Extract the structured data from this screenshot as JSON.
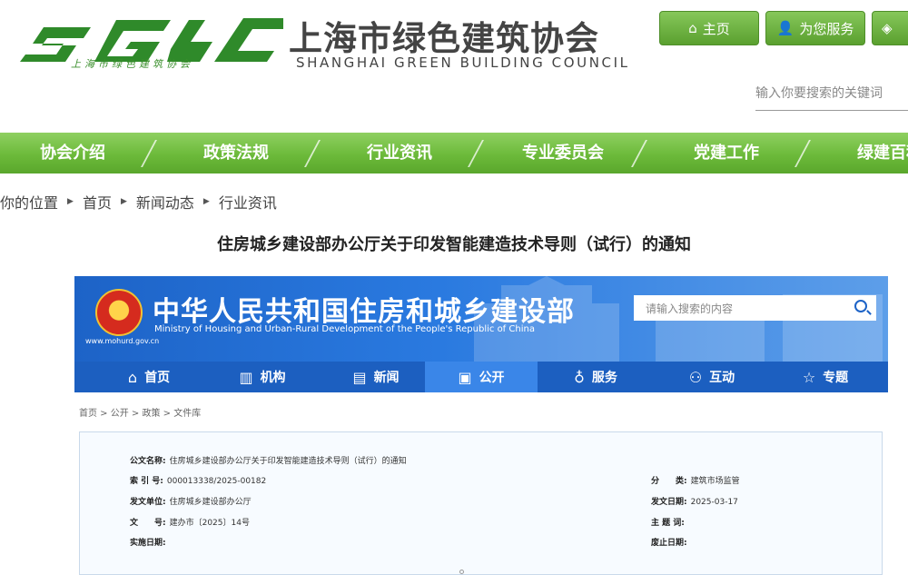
{
  "header": {
    "logo_letters": "SGBC",
    "logo_sub": "上海市绿色建筑协会",
    "org_title": "上海市绿色建筑协会",
    "org_en": "SHANGHAI GREEN BUILDING COUNCIL",
    "buttons": [
      {
        "label": "主页",
        "icon": "home-icon"
      },
      {
        "label": "为您服务",
        "icon": "person-icon"
      },
      {
        "label": "",
        "icon": "tag-icon"
      }
    ],
    "search_placeholder": "输入你要搜索的关键词"
  },
  "nav": {
    "items": [
      "协会介绍",
      "政策法规",
      "行业资讯",
      "专业委员会",
      "党建工作",
      "绿建百科"
    ]
  },
  "breadcrumb": {
    "prefix": "你的位置",
    "items": [
      "首页",
      "新闻动态",
      "行业资讯"
    ]
  },
  "article": {
    "title": "住房城乡建设部办公厅关于印发智能建造技术导则（试行）的通知"
  },
  "ministry": {
    "title": "中华人民共和国住房和城乡建设部",
    "title_en": "Ministry of Housing and Urban-Rural Development of the People's Republic of China",
    "url": "www.mohurd.gov.cn",
    "search_placeholder": "请输入搜索的内容",
    "tabs": [
      {
        "label": "首页",
        "icon": "home-icon"
      },
      {
        "label": "机构",
        "icon": "building-icon"
      },
      {
        "label": "新闻",
        "icon": "newspaper-icon"
      },
      {
        "label": "公开",
        "icon": "document-icon"
      },
      {
        "label": "服务",
        "icon": "service-icon"
      },
      {
        "label": "互动",
        "icon": "interaction-icon"
      },
      {
        "label": "专题",
        "icon": "star-icon"
      }
    ],
    "active_tab": "公开",
    "crumb": "首页 > 公开 > 政策 > 文件库"
  },
  "meta": {
    "doc_name_label": "公文名称:",
    "doc_name": "住房城乡建设部办公厅关于印发智能建造技术导则（试行）的通知",
    "index_label": "索 引 号:",
    "index": "000013338/2025-00182",
    "category_label": "分　　类:",
    "category": "建筑市场监管",
    "issuer_label": "发文单位:",
    "issuer": "住房城乡建设部办公厅",
    "date_label": "发文日期:",
    "date": "2025-03-17",
    "docno_label": "文　　号:",
    "docno": "建办市〔2025〕14号",
    "subject_label": "主 题 词:",
    "subject": "",
    "effective_label": "实施日期:",
    "effective": "",
    "expire_label": "废止日期:",
    "expire": ""
  },
  "colors": {
    "green": "#6cba3a",
    "blue": "#1d63c7"
  }
}
